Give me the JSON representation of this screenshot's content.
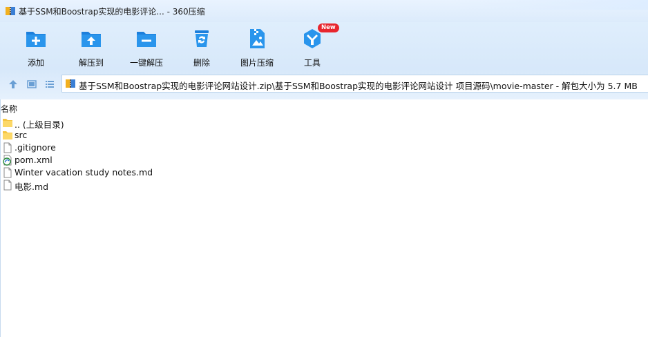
{
  "window": {
    "title": "基于SSM和Boostrap实现的电影评论... - 360压缩"
  },
  "toolbar": {
    "buttons": [
      {
        "label": "添加",
        "icon": "add-folder-icon"
      },
      {
        "label": "解压到",
        "icon": "extract-to-icon"
      },
      {
        "label": "一键解压",
        "icon": "one-click-extract-icon"
      },
      {
        "label": "删除",
        "icon": "delete-bin-icon"
      },
      {
        "label": "图片压缩",
        "icon": "image-compress-icon"
      },
      {
        "label": "工具",
        "icon": "tools-icon",
        "badge": "New"
      }
    ]
  },
  "address": {
    "path": "基于SSM和Boostrap实现的电影评论网站设计.zip\\基于SSM和Boostrap实现的电影评论网站设计 项目源码\\movie-master - 解包大小为 5.7 MB"
  },
  "filelist": {
    "column_name": "名称",
    "items": [
      {
        "name": ".. (上级目录)",
        "icon": "folder-icon"
      },
      {
        "name": "src",
        "icon": "folder-icon"
      },
      {
        "name": ".gitignore",
        "icon": "file-icon"
      },
      {
        "name": "pom.xml",
        "icon": "xml-file-icon"
      },
      {
        "name": "Winter vacation study notes.md",
        "icon": "file-icon"
      },
      {
        "name": "电影.md",
        "icon": "file-icon"
      }
    ]
  },
  "colors": {
    "accent": "#2a8ee6",
    "badge": "#e8262e",
    "toolbar_bg": "#dcebfb"
  }
}
